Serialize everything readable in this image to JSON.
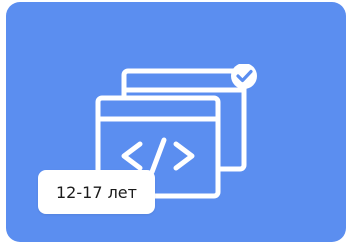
{
  "card": {
    "badge_text": "12-17 лет",
    "icon": "code-windows-check-icon",
    "colors": {
      "background": "#5b8ef0",
      "line": "#ffffff",
      "badge_bg": "#ffffff",
      "badge_text": "#1b1b1b"
    }
  }
}
